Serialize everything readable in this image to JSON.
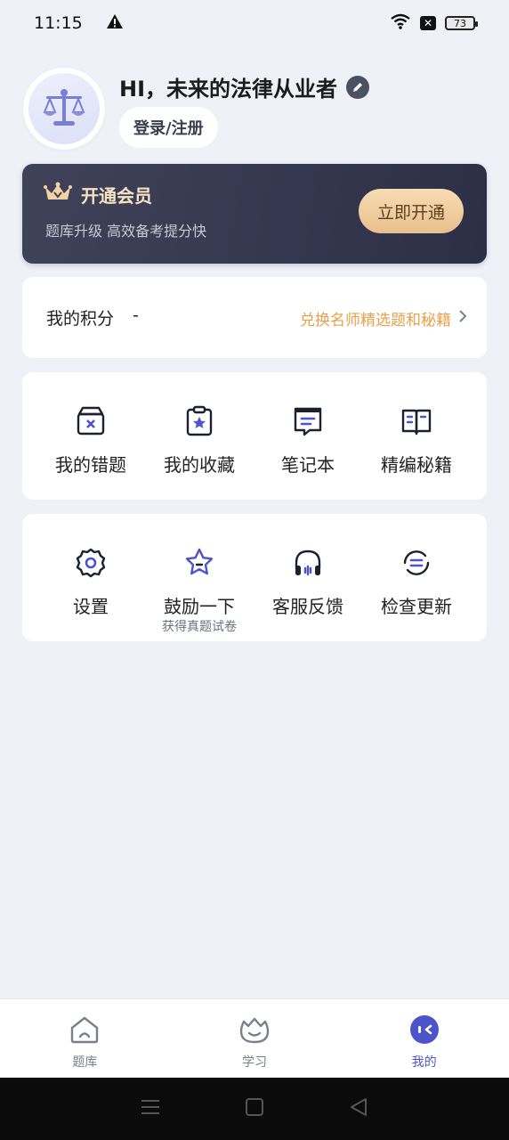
{
  "status_bar": {
    "time": "11:15",
    "battery": "73"
  },
  "profile": {
    "greeting": "HI，未来的法律从业者",
    "login_label": "登录/注册"
  },
  "vip": {
    "title": "开通会员",
    "subtitle": "题库升级 高效备考提分快",
    "button_label": "立即开通"
  },
  "points": {
    "label": "我的积分",
    "value": "-",
    "link_label": "兑换名师精选题和秘籍"
  },
  "tools": [
    {
      "label": "我的错题",
      "icon": "wrong-questions-icon"
    },
    {
      "label": "我的收藏",
      "icon": "favorites-icon"
    },
    {
      "label": "笔记本",
      "icon": "notebook-icon"
    },
    {
      "label": "精编秘籍",
      "icon": "guidebook-icon"
    }
  ],
  "settings": [
    {
      "label": "设置",
      "icon": "gear-icon"
    },
    {
      "label": "鼓励一下",
      "sublabel": "获得真题试卷",
      "icon": "star-icon"
    },
    {
      "label": "客服反馈",
      "icon": "headset-icon"
    },
    {
      "label": "检查更新",
      "icon": "update-icon"
    }
  ],
  "bottom_nav": [
    {
      "label": "题库",
      "icon": "home-icon",
      "active": false
    },
    {
      "label": "学习",
      "icon": "study-icon",
      "active": false
    },
    {
      "label": "我的",
      "icon": "profile-icon",
      "active": true
    }
  ],
  "colors": {
    "accent": "#4d53c8",
    "vip_gold": "#f7e3c4",
    "link_orange": "#e7a04b",
    "background": "#eff1f7"
  }
}
